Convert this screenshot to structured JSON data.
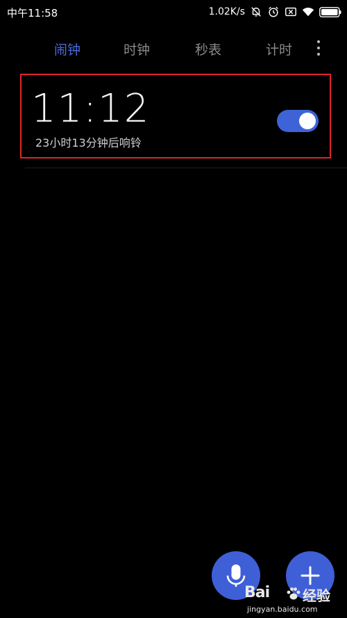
{
  "status_bar": {
    "time": "中午11:58",
    "net_speed": "1.02K/s",
    "icons": [
      "mute-bell-icon",
      "alarm-clock-icon",
      "sim-x-icon",
      "wifi-icon",
      "battery-icon"
    ]
  },
  "tabs": [
    {
      "label": "闹钟",
      "active": true
    },
    {
      "label": "时钟",
      "active": false
    },
    {
      "label": "秒表",
      "active": false
    },
    {
      "label": "计时",
      "active": false
    }
  ],
  "more_menu_icon": "more-vertical-icon",
  "alarms": [
    {
      "time": "11:12",
      "subtitle": "23小时13分钟后响铃",
      "enabled": true
    }
  ],
  "fabs": [
    {
      "icon": "microphone-icon"
    },
    {
      "icon": "plus-icon"
    }
  ],
  "watermark": {
    "logo": "Bai",
    "name": "经验",
    "url": "jingyan.baidu.com"
  },
  "colors": {
    "background": "#000000",
    "accent": "#4a6ce0",
    "toggle_on": "#3e63d6",
    "fab": "#3f5fd6",
    "highlight_border": "#e0242b",
    "tab_inactive": "#8a8a8a"
  }
}
